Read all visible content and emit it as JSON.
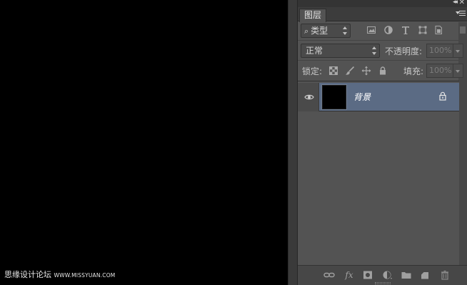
{
  "watermark": {
    "cn": "思缘设计论坛",
    "url": "WWW.MISSYUAN.COM"
  },
  "dock": {
    "collapse_glyph": "◂◂",
    "close_glyph": "✕"
  },
  "layers_panel": {
    "tab_label": "图层",
    "filter": {
      "kind_label": "类型",
      "search_glyph": "⌕"
    },
    "blend": {
      "mode": "正常",
      "opacity_label": "不透明度:",
      "opacity_value": "100%"
    },
    "lock": {
      "label": "锁定:",
      "fill_label": "填充:",
      "fill_value": "100%"
    },
    "layers": [
      {
        "name": "背景",
        "visible": true,
        "locked": true
      }
    ]
  },
  "colors": {
    "panel_bg": "#535353",
    "selected_row": "#5b6b84",
    "canvas": "#000000"
  }
}
